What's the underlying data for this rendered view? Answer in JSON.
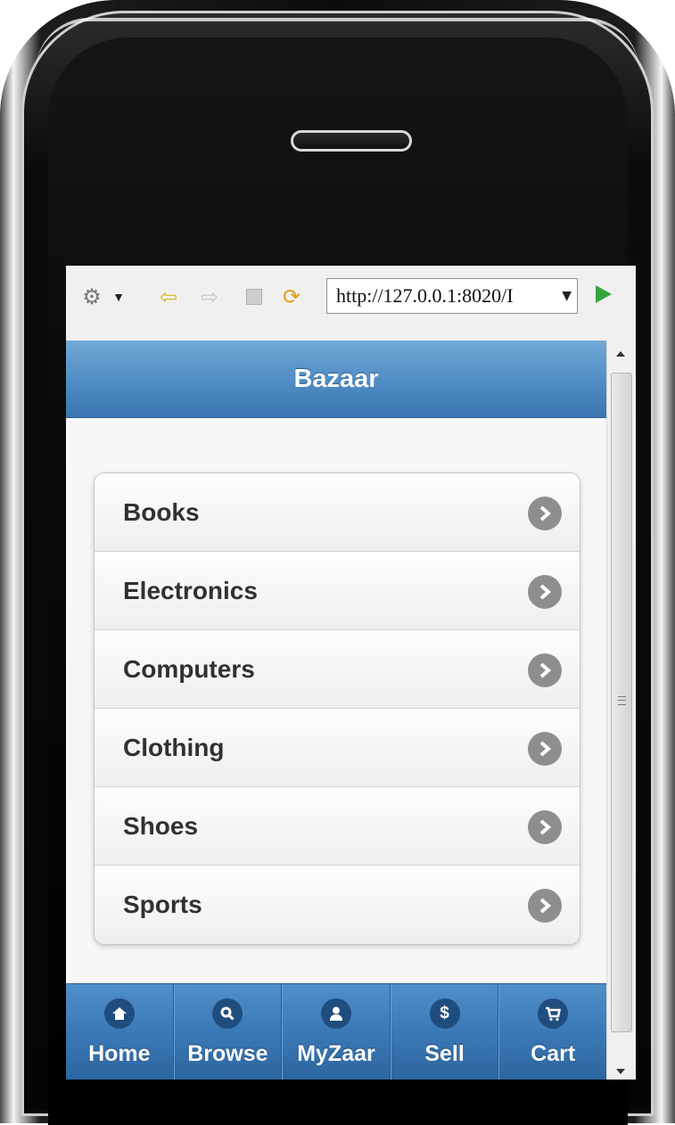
{
  "browser": {
    "url": "http://127.0.0.1:8020/I",
    "icons": [
      "gear-icon",
      "dropdown-icon",
      "back-icon",
      "forward-icon",
      "stop-icon",
      "refresh-icon",
      "go-icon"
    ]
  },
  "header": {
    "title": "Bazaar"
  },
  "categories": [
    {
      "label": "Books"
    },
    {
      "label": "Electronics"
    },
    {
      "label": "Computers"
    },
    {
      "label": "Clothing"
    },
    {
      "label": "Shoes"
    },
    {
      "label": "Sports"
    }
  ],
  "navbar": [
    {
      "label": "Home",
      "icon": "home-icon"
    },
    {
      "label": "Browse",
      "icon": "search-icon"
    },
    {
      "label": "MyZaar",
      "icon": "user-icon"
    },
    {
      "label": "Sell",
      "icon": "dollar-icon"
    },
    {
      "label": "Cart",
      "icon": "cart-icon"
    }
  ],
  "colors": {
    "header": "#4f8cc4",
    "navbar": "#3b79b6",
    "arrow": "#8e8e8e",
    "text": "#2f3133"
  }
}
